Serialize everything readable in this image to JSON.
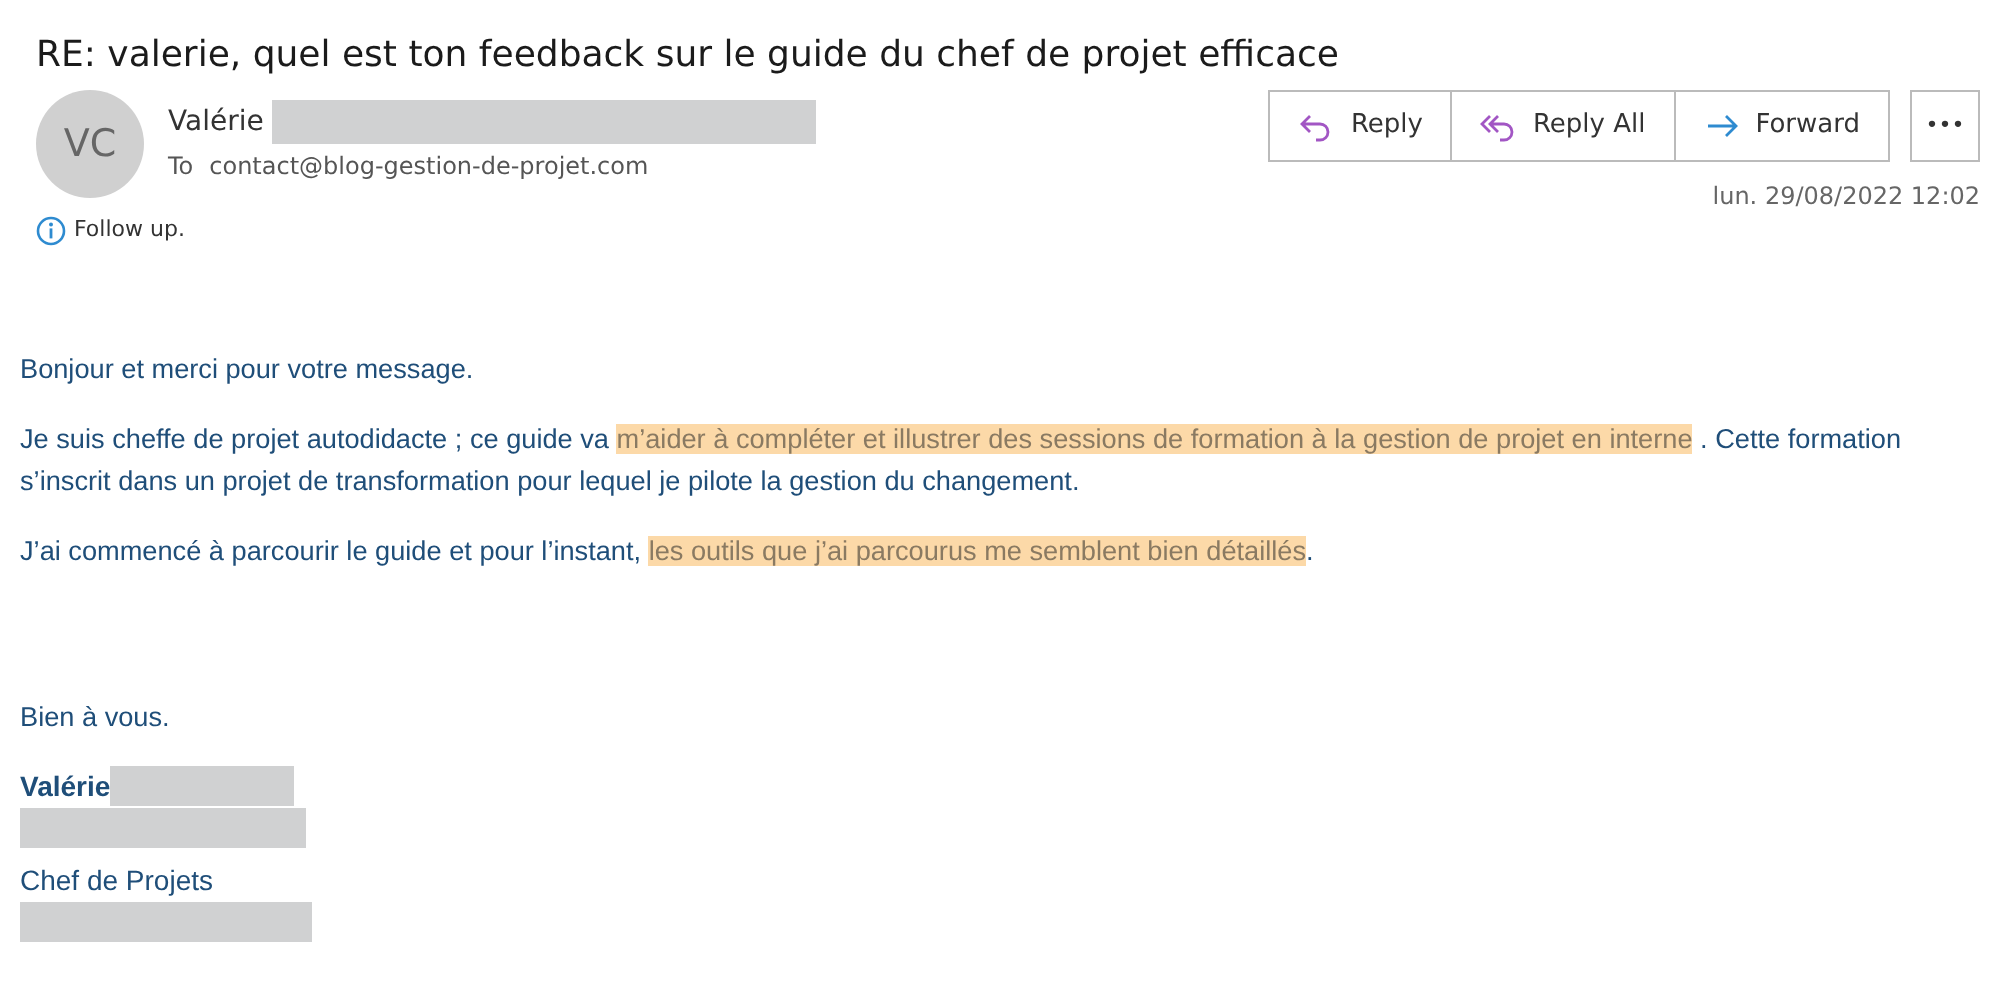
{
  "subject": "RE: valerie, quel est ton feedback sur le guide du chef de projet efficace",
  "sender": {
    "initials": "VC",
    "name": "Valérie",
    "to_label": "To",
    "to": "contact@blog-gestion-de-projet.com"
  },
  "actions": [
    {
      "kind": "reply",
      "label": "Reply"
    },
    {
      "kind": "reply_all",
      "label": "Reply All"
    },
    {
      "kind": "forward",
      "label": "Forward"
    },
    {
      "kind": "more",
      "label": "•••"
    }
  ],
  "date": "lun. 29/08/2022 12:02",
  "info": "Follow up.",
  "body": [
    [
      {
        "text": "Bonjour et merci pour votre message.",
        "highlighted": false
      }
    ],
    [
      {
        "text": "Je suis cheffe de projet autodidacte ; ce guide va ",
        "highlighted": false
      },
      {
        "text": "m’aider à compléter et illustrer des sessions de formation à la gestion de projet en interne",
        "highlighted": true
      },
      {
        "text": " . Cette formation s’inscrit  dans un projet de transformation pour lequel je pilote la gestion du changement.",
        "highlighted": false
      }
    ],
    [
      {
        "text": "J’ai commencé à parcourir le guide et pour l’instant, ",
        "highlighted": false
      },
      {
        "text": "les outils que j’ai parcourus me semblent bien détaillés",
        "highlighted": true
      },
      {
        "text": ".",
        "highlighted": false
      }
    ]
  ],
  "closing": "Bien à vous.",
  "signature": {
    "name": "Valérie",
    "title": "Chef de Projets"
  }
}
